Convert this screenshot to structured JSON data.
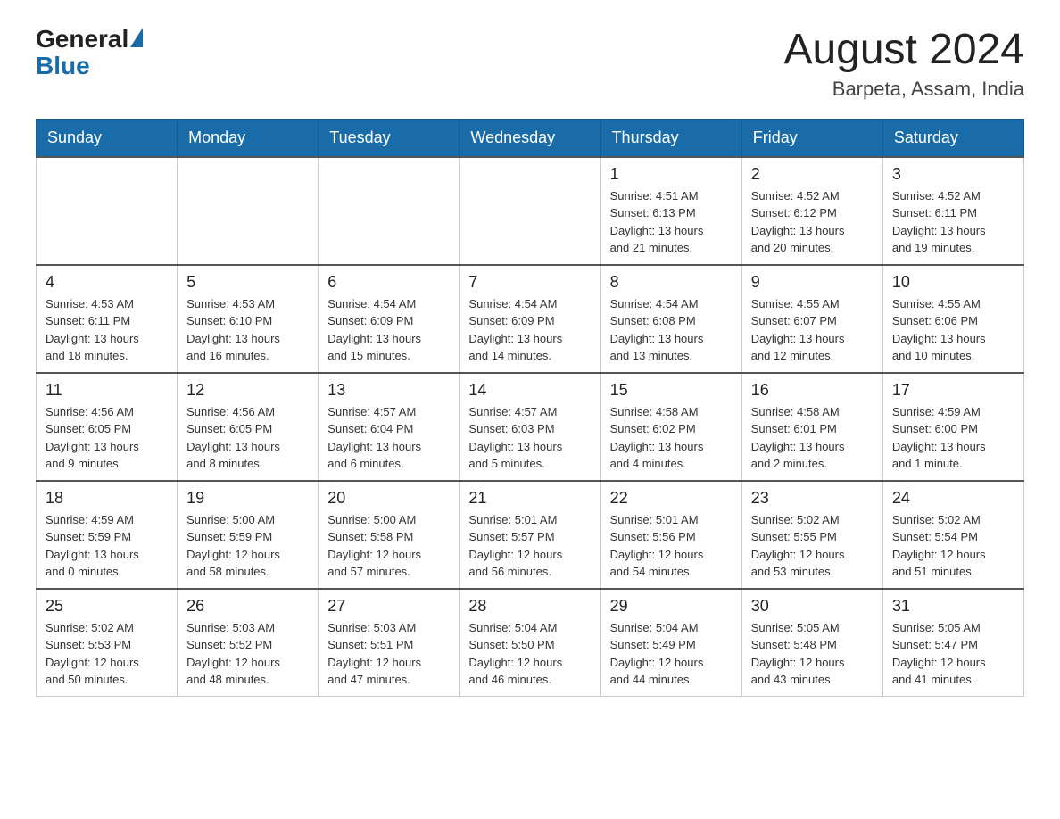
{
  "logo": {
    "general": "General",
    "blue": "Blue"
  },
  "title": "August 2024",
  "subtitle": "Barpeta, Assam, India",
  "days_of_week": [
    "Sunday",
    "Monday",
    "Tuesday",
    "Wednesday",
    "Thursday",
    "Friday",
    "Saturday"
  ],
  "weeks": [
    [
      {
        "day": "",
        "info": ""
      },
      {
        "day": "",
        "info": ""
      },
      {
        "day": "",
        "info": ""
      },
      {
        "day": "",
        "info": ""
      },
      {
        "day": "1",
        "info": "Sunrise: 4:51 AM\nSunset: 6:13 PM\nDaylight: 13 hours\nand 21 minutes."
      },
      {
        "day": "2",
        "info": "Sunrise: 4:52 AM\nSunset: 6:12 PM\nDaylight: 13 hours\nand 20 minutes."
      },
      {
        "day": "3",
        "info": "Sunrise: 4:52 AM\nSunset: 6:11 PM\nDaylight: 13 hours\nand 19 minutes."
      }
    ],
    [
      {
        "day": "4",
        "info": "Sunrise: 4:53 AM\nSunset: 6:11 PM\nDaylight: 13 hours\nand 18 minutes."
      },
      {
        "day": "5",
        "info": "Sunrise: 4:53 AM\nSunset: 6:10 PM\nDaylight: 13 hours\nand 16 minutes."
      },
      {
        "day": "6",
        "info": "Sunrise: 4:54 AM\nSunset: 6:09 PM\nDaylight: 13 hours\nand 15 minutes."
      },
      {
        "day": "7",
        "info": "Sunrise: 4:54 AM\nSunset: 6:09 PM\nDaylight: 13 hours\nand 14 minutes."
      },
      {
        "day": "8",
        "info": "Sunrise: 4:54 AM\nSunset: 6:08 PM\nDaylight: 13 hours\nand 13 minutes."
      },
      {
        "day": "9",
        "info": "Sunrise: 4:55 AM\nSunset: 6:07 PM\nDaylight: 13 hours\nand 12 minutes."
      },
      {
        "day": "10",
        "info": "Sunrise: 4:55 AM\nSunset: 6:06 PM\nDaylight: 13 hours\nand 10 minutes."
      }
    ],
    [
      {
        "day": "11",
        "info": "Sunrise: 4:56 AM\nSunset: 6:05 PM\nDaylight: 13 hours\nand 9 minutes."
      },
      {
        "day": "12",
        "info": "Sunrise: 4:56 AM\nSunset: 6:05 PM\nDaylight: 13 hours\nand 8 minutes."
      },
      {
        "day": "13",
        "info": "Sunrise: 4:57 AM\nSunset: 6:04 PM\nDaylight: 13 hours\nand 6 minutes."
      },
      {
        "day": "14",
        "info": "Sunrise: 4:57 AM\nSunset: 6:03 PM\nDaylight: 13 hours\nand 5 minutes."
      },
      {
        "day": "15",
        "info": "Sunrise: 4:58 AM\nSunset: 6:02 PM\nDaylight: 13 hours\nand 4 minutes."
      },
      {
        "day": "16",
        "info": "Sunrise: 4:58 AM\nSunset: 6:01 PM\nDaylight: 13 hours\nand 2 minutes."
      },
      {
        "day": "17",
        "info": "Sunrise: 4:59 AM\nSunset: 6:00 PM\nDaylight: 13 hours\nand 1 minute."
      }
    ],
    [
      {
        "day": "18",
        "info": "Sunrise: 4:59 AM\nSunset: 5:59 PM\nDaylight: 13 hours\nand 0 minutes."
      },
      {
        "day": "19",
        "info": "Sunrise: 5:00 AM\nSunset: 5:59 PM\nDaylight: 12 hours\nand 58 minutes."
      },
      {
        "day": "20",
        "info": "Sunrise: 5:00 AM\nSunset: 5:58 PM\nDaylight: 12 hours\nand 57 minutes."
      },
      {
        "day": "21",
        "info": "Sunrise: 5:01 AM\nSunset: 5:57 PM\nDaylight: 12 hours\nand 56 minutes."
      },
      {
        "day": "22",
        "info": "Sunrise: 5:01 AM\nSunset: 5:56 PM\nDaylight: 12 hours\nand 54 minutes."
      },
      {
        "day": "23",
        "info": "Sunrise: 5:02 AM\nSunset: 5:55 PM\nDaylight: 12 hours\nand 53 minutes."
      },
      {
        "day": "24",
        "info": "Sunrise: 5:02 AM\nSunset: 5:54 PM\nDaylight: 12 hours\nand 51 minutes."
      }
    ],
    [
      {
        "day": "25",
        "info": "Sunrise: 5:02 AM\nSunset: 5:53 PM\nDaylight: 12 hours\nand 50 minutes."
      },
      {
        "day": "26",
        "info": "Sunrise: 5:03 AM\nSunset: 5:52 PM\nDaylight: 12 hours\nand 48 minutes."
      },
      {
        "day": "27",
        "info": "Sunrise: 5:03 AM\nSunset: 5:51 PM\nDaylight: 12 hours\nand 47 minutes."
      },
      {
        "day": "28",
        "info": "Sunrise: 5:04 AM\nSunset: 5:50 PM\nDaylight: 12 hours\nand 46 minutes."
      },
      {
        "day": "29",
        "info": "Sunrise: 5:04 AM\nSunset: 5:49 PM\nDaylight: 12 hours\nand 44 minutes."
      },
      {
        "day": "30",
        "info": "Sunrise: 5:05 AM\nSunset: 5:48 PM\nDaylight: 12 hours\nand 43 minutes."
      },
      {
        "day": "31",
        "info": "Sunrise: 5:05 AM\nSunset: 5:47 PM\nDaylight: 12 hours\nand 41 minutes."
      }
    ]
  ]
}
